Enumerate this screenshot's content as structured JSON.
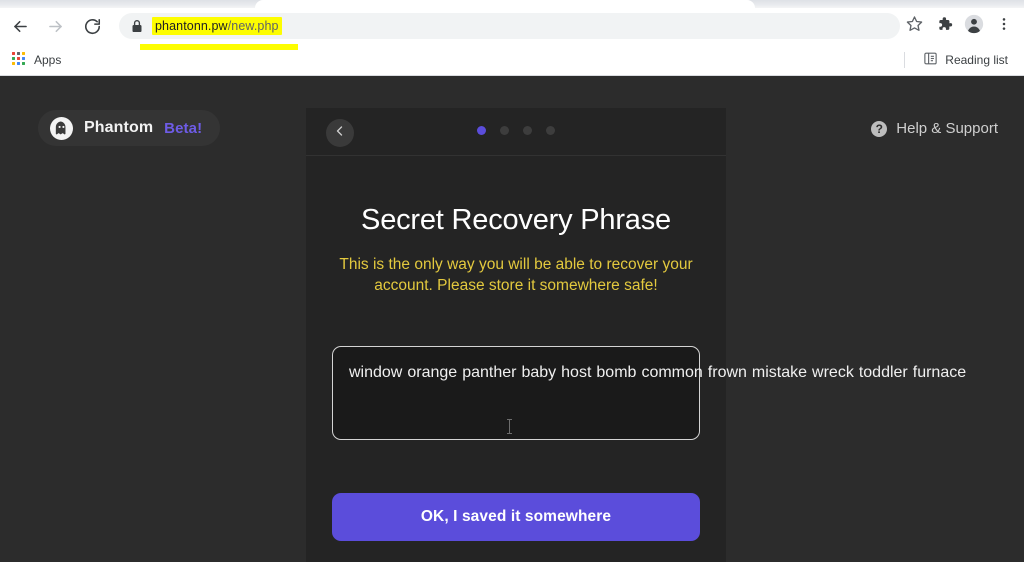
{
  "browser": {
    "nav": {
      "back_label": "Back",
      "forward_label": "Forward",
      "reload_label": "Reload"
    },
    "omnibox": {
      "lock_icon": "lock-icon",
      "url_domain": "phantonn.pw",
      "url_path": "/new.php",
      "highlight_color": "#fdfd00"
    },
    "toolbar_icons": [
      {
        "name": "bookmark-star-icon",
        "label": "Bookmark this tab"
      },
      {
        "name": "extensions-puzzle-icon",
        "label": "Extensions"
      },
      {
        "name": "profile-avatar-icon",
        "label": "Profile"
      },
      {
        "name": "chrome-menu-icon",
        "label": "Customize and control Google Chrome"
      }
    ],
    "bookmarks": {
      "apps_label": "Apps",
      "apps_icon": "apps-grid-icon",
      "reading_list_label": "Reading list",
      "reading_list_icon": "reading-list-icon"
    }
  },
  "page": {
    "background_color": "#2c2c2c",
    "logo": {
      "icon": "phantom-ghost-icon",
      "name": "Phantom",
      "badge": "Beta!",
      "badge_color": "#6e5ce6"
    },
    "help": {
      "icon": "help-question-icon",
      "label": "Help & Support"
    },
    "card": {
      "back_button_icon": "chevron-left-icon",
      "steps": {
        "total": 4,
        "active_index": 0,
        "active_color": "#5b4ddb"
      },
      "title": "Secret Recovery Phrase",
      "subtitle": "This is the only way you will be able to recover your account. Please store it somewhere safe!",
      "subtitle_color": "#e3c93e",
      "recovery_phrase": [
        "window",
        "orange",
        "panther",
        "baby",
        "host",
        "bomb",
        "common",
        "frown",
        "mistake",
        "wreck",
        "toddler",
        "furnace"
      ],
      "cta_label": "OK, I saved it somewhere",
      "cta_color": "#5b4ddb"
    }
  }
}
